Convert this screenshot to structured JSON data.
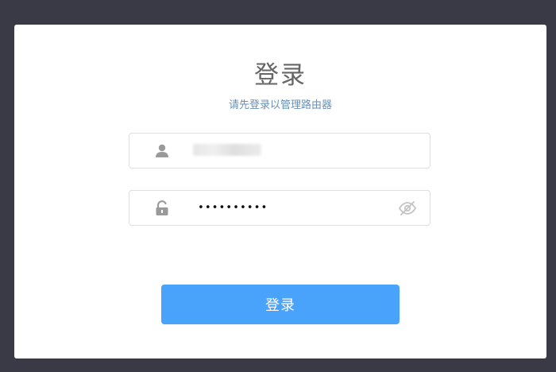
{
  "page": {
    "title": "登录",
    "subtitle": "请先登录以管理路由器"
  },
  "username_field": {
    "icon": "user-icon",
    "value": ""
  },
  "password_field": {
    "icon": "lock-icon",
    "masked_value": "••••••••••",
    "toggle_icon": "eye-off-icon"
  },
  "login_button": {
    "label": "登录"
  },
  "colors": {
    "background": "#3a3a46",
    "card": "#ffffff",
    "accent": "#4aa3fb",
    "subtitle": "#6a8fb4",
    "title": "#666666"
  }
}
